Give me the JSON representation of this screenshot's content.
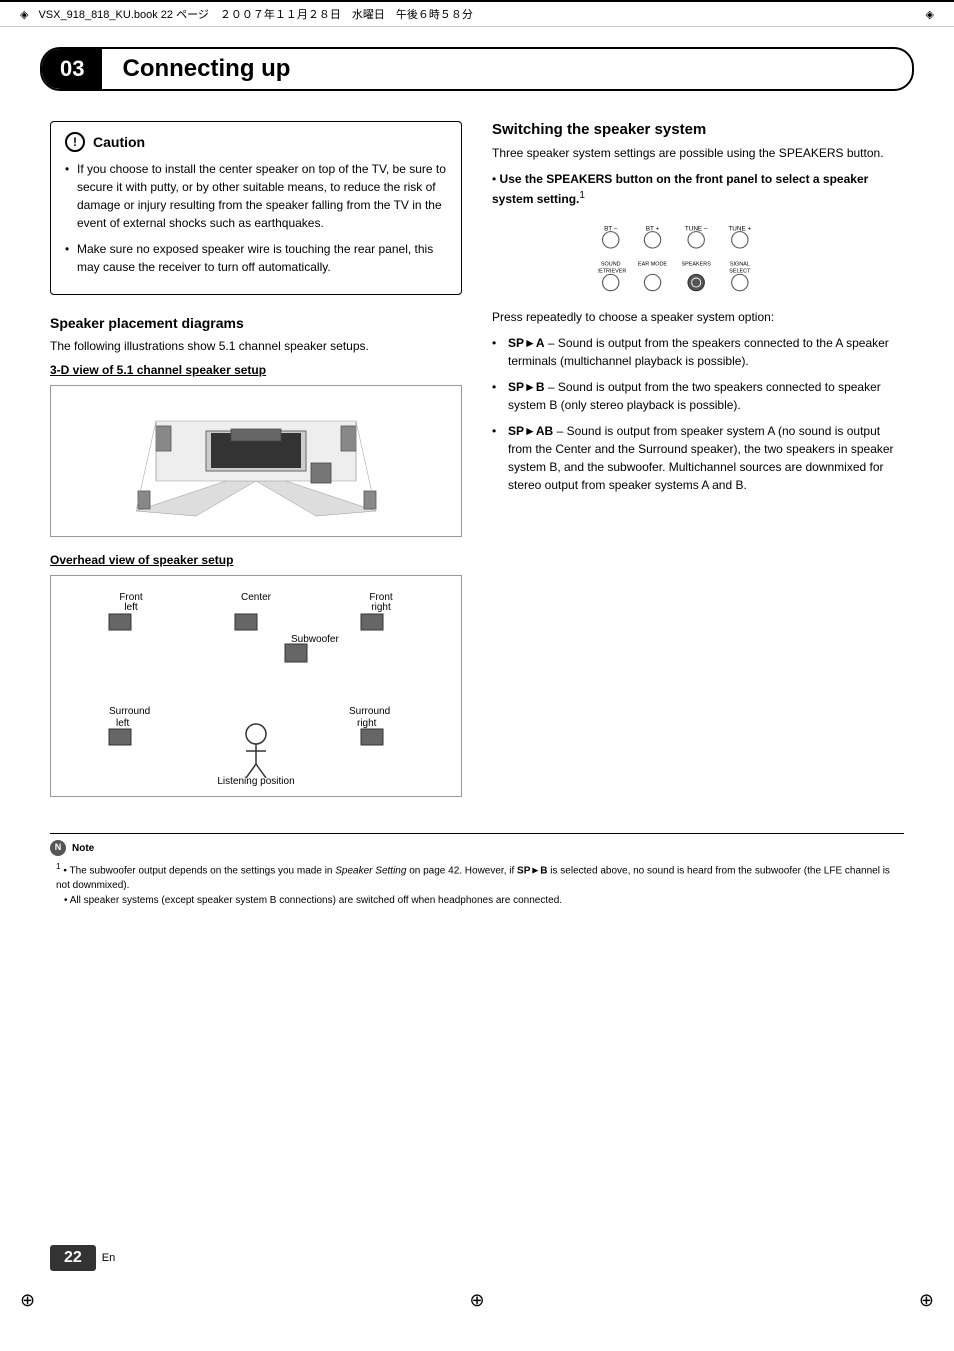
{
  "topbar": {
    "text": "VSX_918_818_KU.book  22 ページ　２００７年１１月２８日　水曜日　午後６時５８分"
  },
  "chapter": {
    "number": "03",
    "title": "Connecting up"
  },
  "caution": {
    "header": "Caution",
    "bullet1": "If you choose to install the center speaker on top of the TV, be sure to secure it with putty, or by other suitable means, to reduce the risk of damage or injury resulting from the speaker falling from the TV in the event of external shocks such as earthquakes.",
    "bullet2": "Make sure no exposed speaker wire is touching the rear panel, this may cause the receiver to turn off automatically."
  },
  "speaker_placement": {
    "title": "Speaker placement diagrams",
    "intro": "The following illustrations show 5.1 channel speaker setups.",
    "view3d_title": "3-D view of 5.1 channel speaker setup",
    "overhead_title": "Overhead view of speaker setup",
    "labels": {
      "front_left": "Front left",
      "center": "Center",
      "front_right": "Front right",
      "subwoofer": "Subwoofer",
      "surround_left": "Surround left",
      "surround_right": "Surround right",
      "listening_position": "Listening position"
    }
  },
  "switching": {
    "title": "Switching the speaker system",
    "intro": "Three speaker system settings are possible using the SPEAKERS button.",
    "bullet_header": "Use the SPEAKERS button on the front panel to select a speaker system setting.",
    "footnote_ref": "1",
    "press_text": "Press repeatedly to choose a speaker system option:",
    "options": [
      {
        "label": "SP►A",
        "text": "Sound is output from the speakers connected to the A speaker terminals (multichannel playback is possible)."
      },
      {
        "label": "SP►B",
        "text": "Sound is output from the two speakers connected to speaker system B (only stereo playback is possible)."
      },
      {
        "label": "SP►AB",
        "text": "Sound is output from speaker system A (no sound is output from the Center and the Surround speaker), the two speakers in speaker system B, and the subwoofer. Multichannel sources are downmixed for stereo output from speaker systems A and B."
      }
    ]
  },
  "note": {
    "header": "Note",
    "footnote_num": "1",
    "lines": [
      "The subwoofer output depends on the settings you made in Speaker Setting on page 42. However, if SP►B is selected above, no sound is heard from the subwoofer (the LFE channel is not downmixed).",
      "All speaker systems (except speaker system B connections) are switched off when headphones are connected."
    ]
  },
  "page": {
    "number": "22",
    "lang": "En"
  },
  "button_labels": {
    "bt_minus": "BT –",
    "bt_plus": "BT +",
    "tune_minus": "TUNE –",
    "tune_plus": "TUNE +",
    "sound_retriever": "SOUND RETRIEVER",
    "ear_mode": "EAR MODE",
    "speakers": "SPEAKERS",
    "signal_select": "SIGNAL SELECT"
  }
}
